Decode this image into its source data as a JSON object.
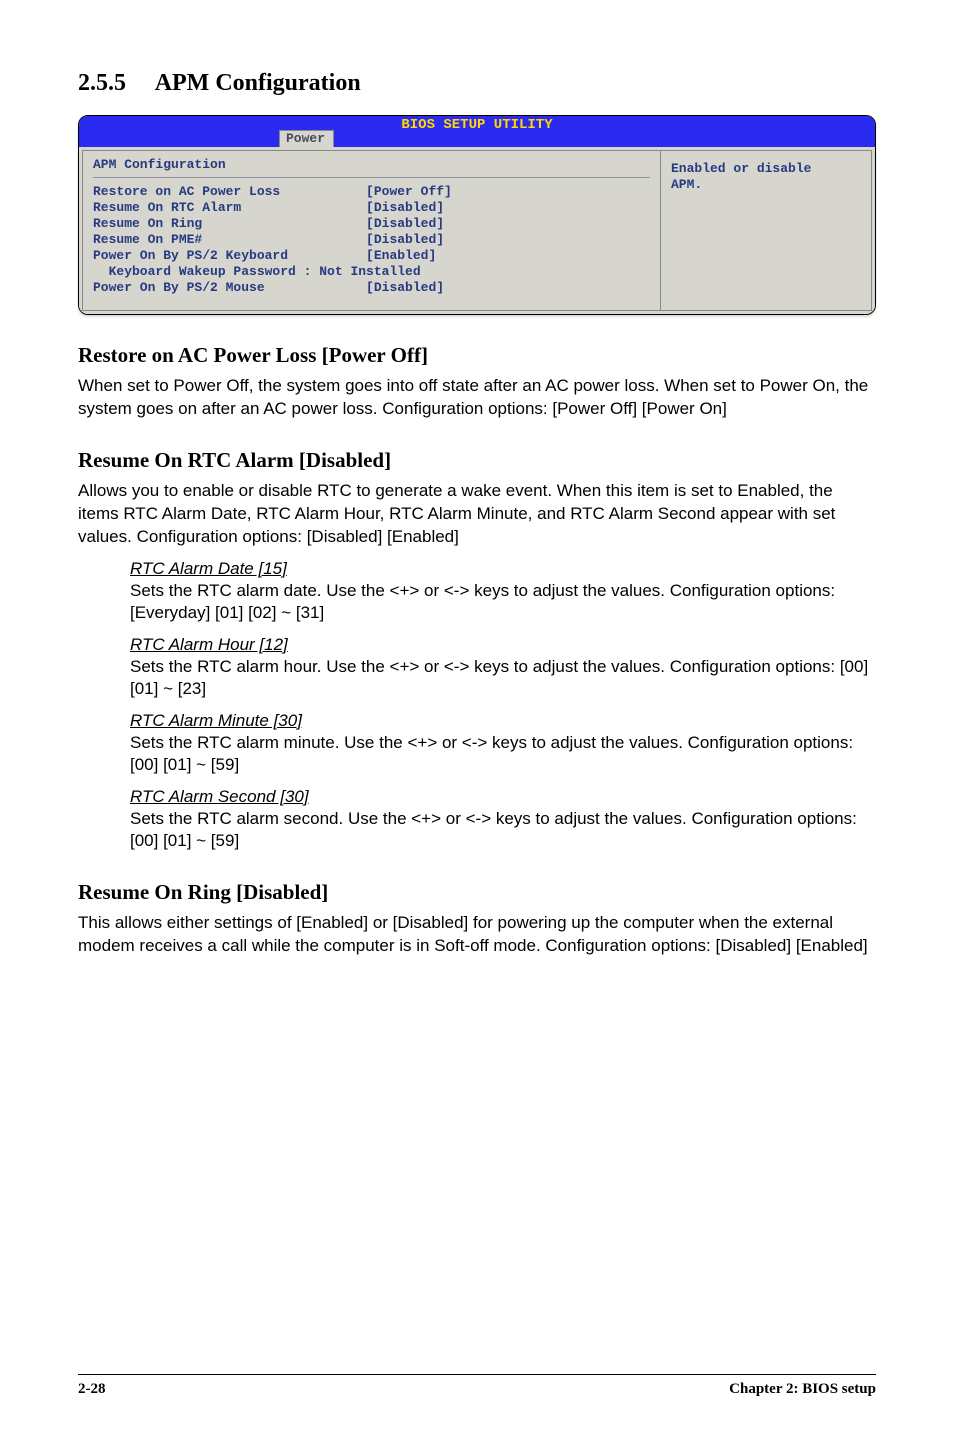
{
  "section": {
    "number": "2.5.5",
    "title": "APM Configuration"
  },
  "bios": {
    "header_title": "BIOS SETUP UTILITY",
    "tab": "Power",
    "panel_title": "APM Configuration",
    "rows_text": "Restore on AC Power Loss           [Power Off]\nResume On RTC Alarm                [Disabled]\nResume On Ring                     [Disabled]\nResume On PME#                     [Disabled]\nPower On By PS/2 Keyboard          [Enabled]\n  Keyboard Wakeup Password : Not Installed\nPower On By PS/2 Mouse             [Disabled]",
    "help_text": "Enabled or disable\nAPM."
  },
  "h3_1": "Restore on AC Power Loss [Power Off]",
  "p_1": "When set to Power Off, the system goes into off state after an AC power loss. When set to Power On, the system goes on after an AC power loss. Configuration options: [Power Off] [Power On]",
  "h3_2": "Resume On RTC Alarm [Disabled]",
  "p_2": "Allows you to enable or disable RTC to generate a wake event. When this item is set to Enabled, the items RTC Alarm Date, RTC Alarm Hour, RTC Alarm Minute, and RTC Alarm Second appear with set values. Configuration options: [Disabled] [Enabled]",
  "sub_items": [
    {
      "title": "RTC Alarm Date [15]",
      "body": "Sets the RTC alarm date. Use the <+> or <-> keys to adjust the values. Configuration options: [Everyday] [01] [02] ~ [31]"
    },
    {
      "title": "RTC Alarm Hour [12]",
      "body": "Sets the RTC alarm hour. Use the <+> or <-> keys to adjust the values. Configuration options: [00] [01] ~ [23]"
    },
    {
      "title": "RTC Alarm Minute [30]",
      "body": "Sets the RTC alarm minute. Use the <+> or <-> keys to adjust the values. Configuration options: [00] [01] ~ [59]"
    },
    {
      "title": "RTC Alarm Second [30]",
      "body": "Sets the RTC alarm second. Use the <+> or <-> keys to adjust the values. Configuration options: [00] [01] ~ [59]"
    }
  ],
  "h3_3": "Resume On Ring [Disabled]",
  "p_3": "This allows either settings of [Enabled] or [Disabled] for powering up the computer when the external modem receives a call while the computer is in Soft-off mode. Configuration options: [Disabled] [Enabled]",
  "footer": {
    "page": "2-28",
    "chapter": "Chapter 2: BIOS setup"
  }
}
